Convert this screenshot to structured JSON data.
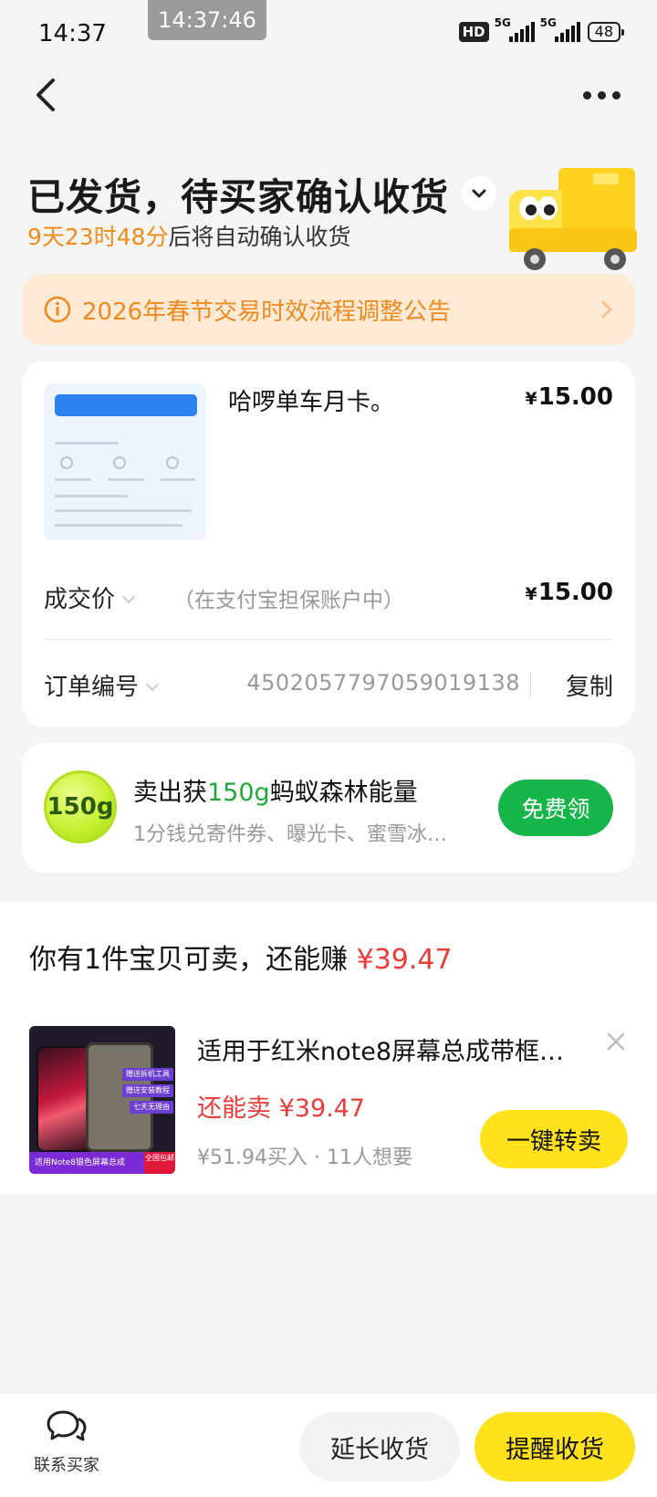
{
  "status_bar": {
    "time": "14:37",
    "pill_time": "14:37:46",
    "hd": "HD",
    "net1": "5G",
    "net2": "5G",
    "battery": "48"
  },
  "header": {
    "title": "已发货，待买家确认收货",
    "countdown": "9天23时48分",
    "countdown_suffix": "后将自动确认收货"
  },
  "notice": {
    "text": "2026年春节交易时效流程调整公告"
  },
  "order": {
    "product_name": "哈啰单车月卡。",
    "currency": "¥",
    "product_price": "15.00",
    "deal_label": "成交价",
    "deal_note": "（在支付宝担保账户中）",
    "deal_price": "15.00",
    "order_label": "订单编号",
    "order_no": "4502057797059019138",
    "copy": "复制"
  },
  "energy": {
    "badge": "150g",
    "title_prefix": "卖出获",
    "title_amount": "150g",
    "title_suffix": "蚂蚁森林能量",
    "subtitle": "1分钱兑寄件券、曝光卡、蜜雪冰…",
    "button": "免费领"
  },
  "resale": {
    "title_prefix": "你有1件宝贝可卖，还能赚 ",
    "title_amount": "¥39.47",
    "item": {
      "name": "适用于红米note8屏幕总成带框…",
      "price_label": "还能卖 ¥39.47",
      "meta": "¥51.94买入 · 11人想要",
      "button": "一键转卖",
      "img_tags": [
        "赠送拆机工具",
        "赠送安装教程",
        "七天无理由"
      ],
      "img_band": "适用Note8银色屏幕总成",
      "img_badge": "全国包邮"
    }
  },
  "bottom": {
    "contact": "联系买家",
    "extend": "延长收货",
    "remind": "提醒收货"
  },
  "colors": {
    "accent_yellow": "#ffe21c",
    "countdown_orange": "#f08c19",
    "price_red": "#ec3b3b",
    "green": "#16b64a"
  }
}
